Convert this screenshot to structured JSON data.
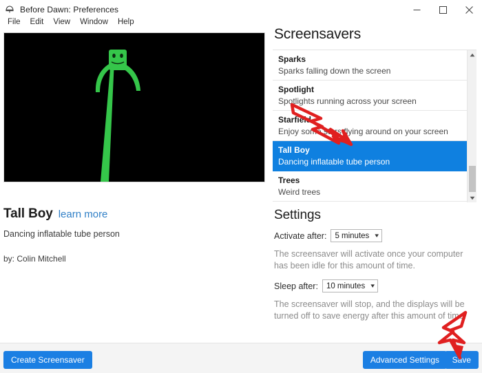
{
  "window": {
    "title": "Before Dawn: Preferences",
    "icon": "lamp-icon",
    "controls": {
      "minimize": "minimize-icon",
      "maximize": "maximize-icon",
      "close": "close-icon"
    }
  },
  "menubar": {
    "items": [
      {
        "label": "File"
      },
      {
        "label": "Edit"
      },
      {
        "label": "View"
      },
      {
        "label": "Window"
      },
      {
        "label": "Help"
      }
    ]
  },
  "preview": {
    "name": "screensaver-preview",
    "background": "#000000",
    "figure_color": "#35c64a",
    "description": "Green inflatable tube person waving on a black background"
  },
  "detail": {
    "name": "Tall Boy",
    "learn_more": "learn more",
    "description": "Dancing inflatable tube person",
    "author": "by: Colin Mitchell"
  },
  "screensavers": {
    "heading": "Screensavers",
    "items": [
      {
        "name": "Sparks",
        "description": "Sparks falling down the screen",
        "selected": false
      },
      {
        "name": "Spotlight",
        "description": "Spotlights running across your screen",
        "selected": false
      },
      {
        "name": "Starfield",
        "description": "Enjoy some stars flying around on your screen",
        "selected": false
      },
      {
        "name": "Tall Boy",
        "description": "Dancing inflatable tube person",
        "selected": true
      },
      {
        "name": "Trees",
        "description": "Weird trees",
        "selected": false
      }
    ],
    "selected_color": "#0f80e0",
    "scrollbar": {
      "up_arrow": "chevron-up-icon",
      "down_arrow": "chevron-down-icon"
    }
  },
  "settings": {
    "heading": "Settings",
    "activate": {
      "label": "Activate after:",
      "value": "5 minutes",
      "caret": "chevron-down-icon",
      "help": "The screensaver will activate once your computer has been idle for this amount of time."
    },
    "sleep": {
      "label": "Sleep after:",
      "value": "10 minutes",
      "caret": "chevron-down-icon",
      "help": "The screensaver will stop, and the displays will be turned off to save energy after this amount of time."
    }
  },
  "footer": {
    "create_label": "Create Screensaver",
    "advanced_label": "Advanced Settings",
    "save_label": "Save",
    "button_color": "#1b7fe3"
  },
  "annotations": {
    "color": "#e02020",
    "list_arrow": "red-lightning-arrow-pointing-at-tall-boy",
    "save_arrow": "red-lightning-arrow-pointing-at-save"
  }
}
